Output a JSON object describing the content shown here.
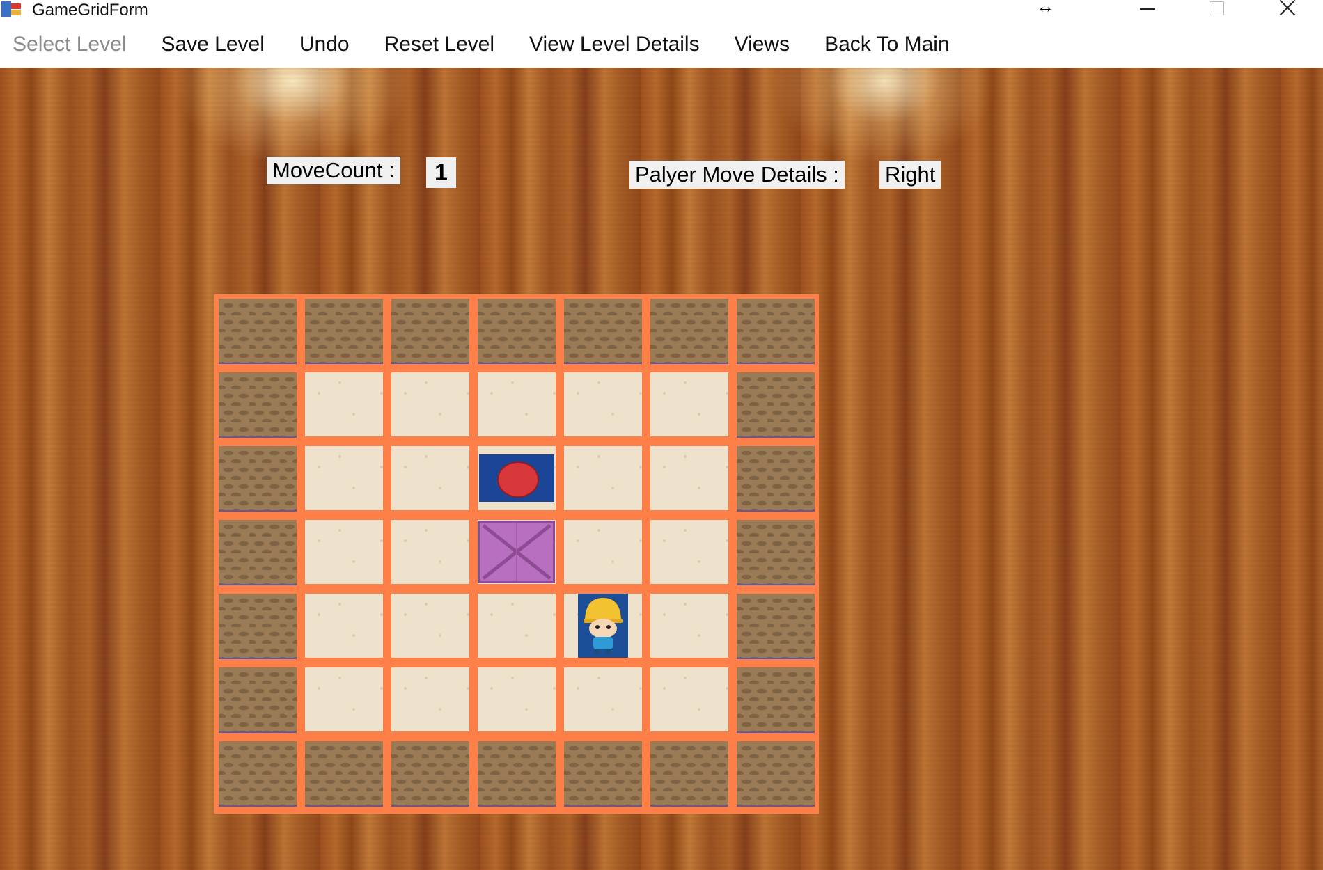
{
  "window": {
    "title": "GameGridForm"
  },
  "menu": {
    "items": [
      {
        "label": "Select Level",
        "enabled": false
      },
      {
        "label": "Save Level",
        "enabled": true
      },
      {
        "label": "Undo",
        "enabled": true
      },
      {
        "label": "Reset Level",
        "enabled": true
      },
      {
        "label": "View Level Details",
        "enabled": true
      },
      {
        "label": "Views",
        "enabled": true
      },
      {
        "label": "Back To Main",
        "enabled": true
      }
    ]
  },
  "status": {
    "move_count_label": "MoveCount :",
    "move_count_value": "1",
    "move_details_label": "Palyer Move Details :",
    "move_details_value": "Right"
  },
  "board": {
    "rows": 7,
    "cols": 7,
    "legend": {
      "W": "wall",
      "F": "floor",
      "T": "target",
      "C": "crate",
      "P": "player"
    },
    "grid": [
      "WWWWWWW",
      "WFFFFFW",
      "WFFTFFW",
      "WFFCFFW",
      "WFFFPFW",
      "WFFFFFW",
      "WWWWWWW"
    ]
  },
  "colors": {
    "grid_border": "#ff7f49",
    "target_bg": "#1b4596",
    "target_dot": "#d8373c",
    "crate": "#b86fbf",
    "player_bg": "#1d4e98",
    "player_helmet": "#f2c230"
  },
  "icons": {
    "app": "windows-form-icon",
    "resize": "resize-arrows-icon",
    "minimize": "minimize-icon",
    "maximize": "maximize-icon",
    "close": "close-icon"
  }
}
